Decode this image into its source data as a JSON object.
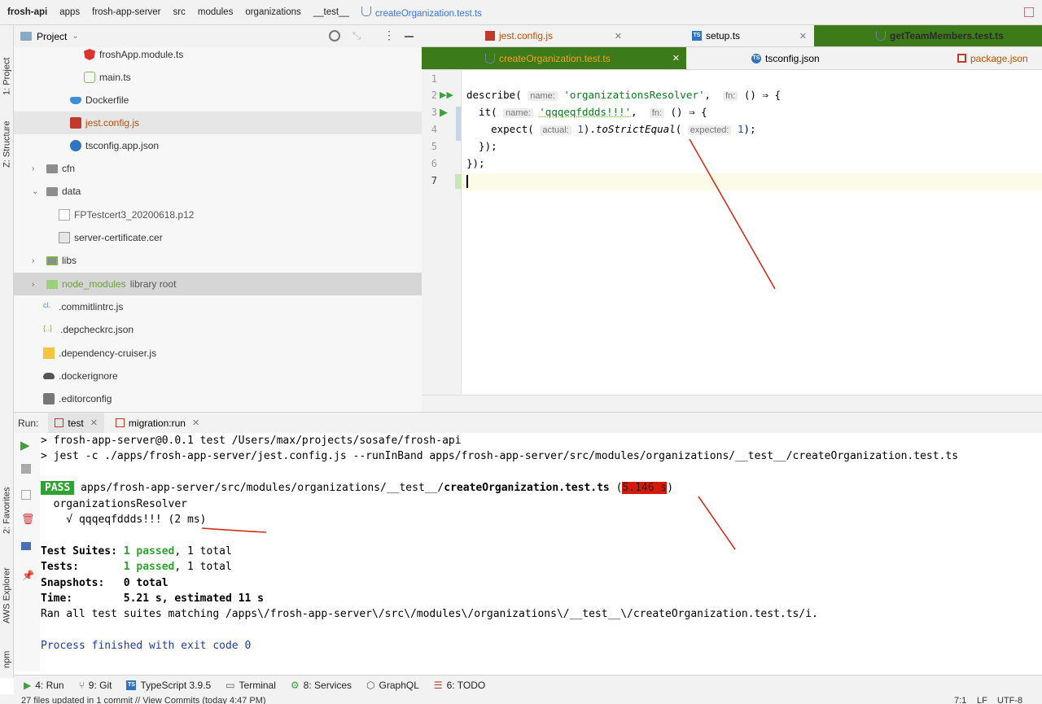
{
  "breadcrumbs": [
    "frosh-api",
    "apps",
    "frosh-app-server",
    "src",
    "modules",
    "organizations",
    "__test__",
    "createOrganization.test.ts"
  ],
  "left_strip": {
    "project": "1: Project",
    "structure": "Z: Structure",
    "favorites": "2: Favorites",
    "aws": "AWS Explorer",
    "npm": "npm"
  },
  "project_header": {
    "label": "Project"
  },
  "tree": [
    {
      "label": "froshApp.module.ts",
      "icon": "angular-icon"
    },
    {
      "label": "main.ts",
      "icon": "ts-file-icon"
    },
    {
      "label": "Dockerfile",
      "icon": "docker-icon"
    },
    {
      "label": "jest.config.js",
      "icon": "jest-icon"
    },
    {
      "label": "tsconfig.app.json",
      "icon": "ts-config-icon"
    },
    {
      "label": "cfn",
      "icon": "folder-icon"
    },
    {
      "label": "data",
      "icon": "folder-icon"
    },
    {
      "label": "FPTestcert3_20200618.p12",
      "icon": "file-icon"
    },
    {
      "label": "server-certificate.cer",
      "icon": "cert-icon"
    },
    {
      "label": "libs",
      "icon": "folder-icon"
    },
    {
      "label": "node_modules",
      "suffix": "library root",
      "icon": "folder-icon"
    },
    {
      "label": ".commitlintrc.js",
      "icon": "config-icon"
    },
    {
      "label": ".depcheckrc.json",
      "icon": "json-icon"
    },
    {
      "label": ".dependency-cruiser.js",
      "icon": "js-icon"
    },
    {
      "label": ".dockerignore",
      "icon": "docker-icon"
    },
    {
      "label": ".editorconfig",
      "icon": "config-icon"
    }
  ],
  "tabs_row1": [
    {
      "label": "jest.config.js"
    },
    {
      "label": "setup.ts"
    },
    {
      "label": "getTeamMembers.test.ts"
    }
  ],
  "tabs_row2": [
    {
      "label": "createOrganization.test.ts"
    },
    {
      "label": "tsconfig.json"
    },
    {
      "label": "package.json"
    }
  ],
  "editor": {
    "line_numbers": [
      "1",
      "2",
      "3",
      "4",
      "5",
      "6",
      "7"
    ],
    "line2": {
      "a": "describe(",
      "hint1": "name:",
      "str": "'organizationsResolver'",
      "b": ",",
      "hint2": "fn:",
      "c": "() ⇒ {"
    },
    "line3": {
      "a": "  it(",
      "hint1": "name:",
      "str": "'qqqeqfddds!!!'",
      "b": ",",
      "hint2": "fn:",
      "c": "() ⇒ {"
    },
    "line4": {
      "a": "    expect(",
      "hint1": "actual:",
      "num1": "1",
      "b": ").",
      "meth": "toStrictEqual",
      "c": "(",
      "hint2": "expected:",
      "num2": "1",
      "d": ");"
    },
    "line5": "  });",
    "line6": "});"
  },
  "run": {
    "label": "Run:",
    "tabs": [
      "test",
      "migration:run"
    ]
  },
  "console": {
    "l1": "> frosh-app-server@0.0.1 test /Users/max/projects/sosafe/frosh-api",
    "l2": "> jest -c ./apps/frosh-app-server/jest.config.js --runInBand apps/frosh-app-server/src/modules/organizations/__test__/createOrganization.test.ts",
    "pass": "PASS",
    "path": " apps/frosh-app-server/src/modules/organizations/__test__/",
    "file": "createOrganization.test.ts",
    "paren_open": " (",
    "duration": "5.146 s",
    "paren_close": ")",
    "suite": "  organizationsResolver",
    "test_line": "    √ qqqeqfddds!!! (2 ms)",
    "suites_label": "Test Suites: ",
    "suites_passed": "1 passed",
    "suites_total": ", 1 total",
    "tests_label": "Tests:       ",
    "tests_passed": "1 passed",
    "tests_total": ", 1 total",
    "snapshots": "Snapshots:   0 total",
    "time": "Time:        5.21 s, estimated 11 s",
    "ran": "Ran all test suites matching /apps\\/frosh-app-server\\/src\\/modules\\/organizations\\/__test__\\/createOrganization.test.ts/i.",
    "exit": "Process finished with exit code 0"
  },
  "bottom_tools": [
    {
      "label": "4: Run",
      "icon": "play-icon"
    },
    {
      "label": "9: Git",
      "icon": "git-icon"
    },
    {
      "label": "TypeScript 3.9.5",
      "icon": "ts-icon"
    },
    {
      "label": "Terminal",
      "icon": "terminal-icon"
    },
    {
      "label": "8: Services",
      "icon": "services-icon"
    },
    {
      "label": "GraphQL",
      "icon": "graphql-icon"
    },
    {
      "label": "6: TODO",
      "icon": "todo-icon"
    }
  ],
  "status": {
    "left": "27 files updated in 1 commit // View Commits (today 4:47 PM)",
    "pos": "7:1",
    "lf": "LF",
    "enc": "UTF-8"
  },
  "colors": {
    "annotation_red": "#d0301c",
    "active_tab_bg": "#3d7a1a",
    "pass_green": "#2fa32f"
  }
}
